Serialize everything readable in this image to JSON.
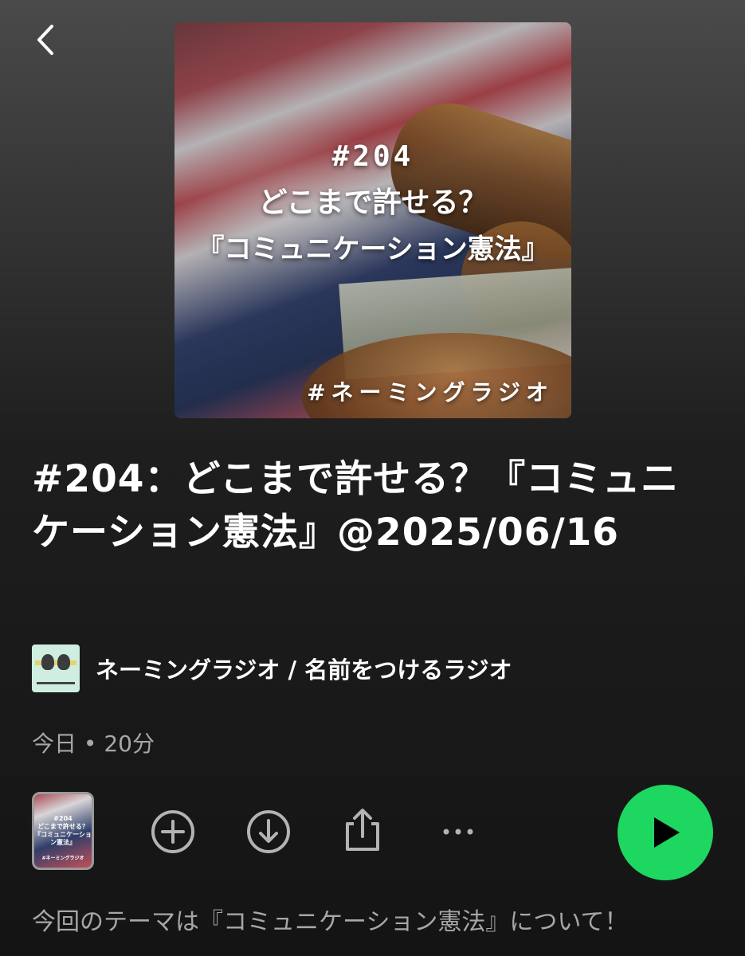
{
  "header": {
    "back_icon": "chevron-left-icon"
  },
  "cover": {
    "title_line1": "#204",
    "title_line2": "どこまで許せる？",
    "title_line3": "『コミュニケーション憲法』",
    "tag": "#ネーミングラジオ"
  },
  "episode": {
    "title": "#204：どこまで許せる？『コミュニケーション憲法』@2025/06/16",
    "show_name": "ネーミングラジオ / 名前をつけるラジオ",
    "meta": "今日 • 20分",
    "description": "今回のテーマは『コミュニケーション憲法』について！"
  },
  "actions": {
    "add_icon": "plus-circle-icon",
    "download_icon": "download-circle-icon",
    "share_icon": "share-icon",
    "more_icon": "more-horizontal-icon",
    "play_icon": "play-icon",
    "play_color": "#1ed760"
  }
}
